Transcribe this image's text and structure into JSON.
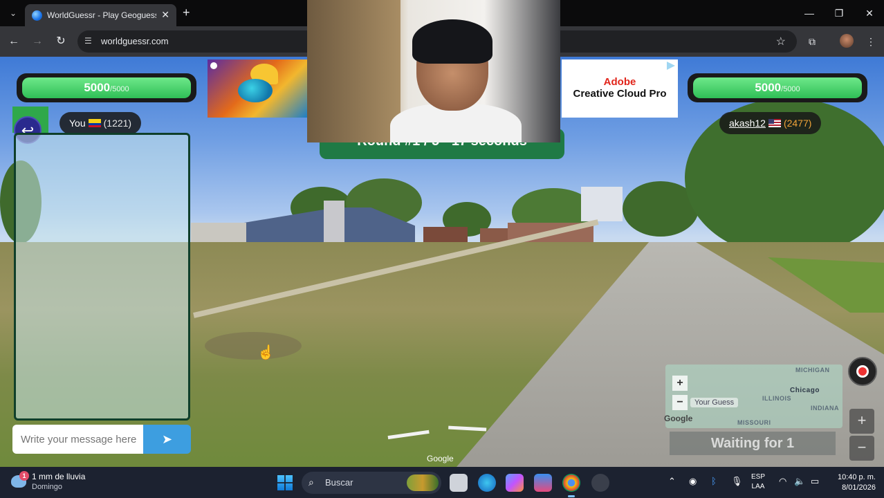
{
  "browser": {
    "tab_title": "WorldGuessr - Play Geoguessr Free",
    "url": "worldguessr.com",
    "window_controls": [
      "minimize-icon",
      "maximize-icon",
      "close-icon"
    ]
  },
  "game": {
    "left_score": {
      "value": "5000",
      "max": "/5000"
    },
    "right_score": {
      "value": "5000",
      "max": "/5000"
    },
    "you": {
      "label": "You",
      "flag": "colombia-flag",
      "elo": "(1221)"
    },
    "opponent": {
      "name": "akash12",
      "flag": "usa-flag",
      "elo": "(2477)"
    },
    "round_banner": "Round #1 / 5 - 17 seconds",
    "waiting_text": "Waiting for 1",
    "google_mark": "Google"
  },
  "chat": {
    "placeholder": "Write your message here"
  },
  "ads": {
    "adobe_brand": "Adobe",
    "adobe_product": "Creative Cloud Pro"
  },
  "minimap": {
    "your_guess": "Your Guess",
    "labels": [
      "MICHIGAN",
      "Chicago",
      "ILLINOIS",
      "INDIANA",
      "MISSOURI"
    ],
    "attribution": "Google",
    "zoom_in": "+",
    "zoom_out": "−"
  },
  "map_controls": {
    "zoom_in": "+",
    "zoom_out": "−"
  },
  "taskbar": {
    "weather_title": "1 mm de lluvia",
    "weather_sub": "Domingo",
    "weather_badge": "1",
    "search_placeholder": "Buscar",
    "lang_1": "ESP",
    "lang_2": "LAA",
    "time": "10:40 p. m.",
    "date": "8/01/2026"
  },
  "colors": {
    "score_green": "#2fbf56",
    "round_banner": "#1f7a45",
    "send_button": "#3d9ee0",
    "opponent_elo": "#f0a338"
  }
}
